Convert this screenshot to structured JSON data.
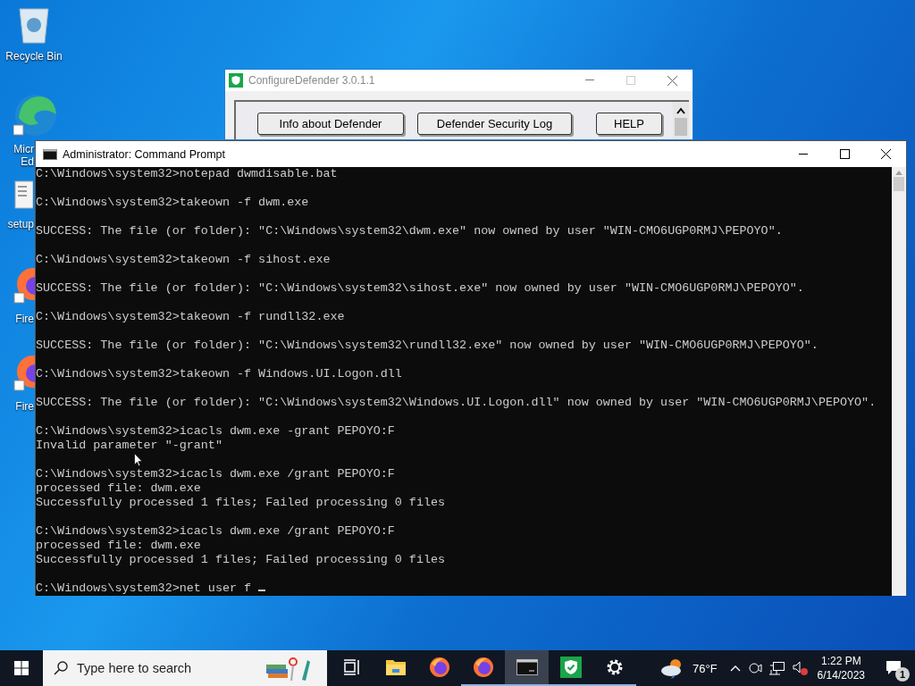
{
  "desktop_icons": [
    {
      "kind": "recycle-bin",
      "label_lines": [
        "Recycle Bin"
      ]
    },
    {
      "kind": "edge",
      "label_lines": [
        "Micr",
        "Ed"
      ]
    },
    {
      "kind": "setup",
      "label_lines": [
        "setup"
      ]
    },
    {
      "kind": "firefox",
      "label_lines": [
        "Fire"
      ]
    },
    {
      "kind": "firefox",
      "label_lines": [
        "Fire"
      ]
    }
  ],
  "defender_window": {
    "title": "ConfigureDefender 3.0.1.1",
    "buttons": [
      "Info about Defender",
      "Defender Security Log",
      "HELP"
    ]
  },
  "console_window": {
    "title": "Administrator: Command Prompt",
    "blocks": [
      [
        "C:\\Windows\\system32>notepad dwmdisable.bat"
      ],
      [
        "C:\\Windows\\system32>takeown -f dwm.exe"
      ],
      [
        "SUCCESS: The file (or folder): \"C:\\Windows\\system32\\dwm.exe\" now owned by user \"WIN-CMO6UGP0RMJ\\PEPOYO\"."
      ],
      [
        "C:\\Windows\\system32>takeown -f sihost.exe"
      ],
      [
        "SUCCESS: The file (or folder): \"C:\\Windows\\system32\\sihost.exe\" now owned by user \"WIN-CMO6UGP0RMJ\\PEPOYO\"."
      ],
      [
        "C:\\Windows\\system32>takeown -f rundll32.exe"
      ],
      [
        "SUCCESS: The file (or folder): \"C:\\Windows\\system32\\rundll32.exe\" now owned by user \"WIN-CMO6UGP0RMJ\\PEPOYO\"."
      ],
      [
        "C:\\Windows\\system32>takeown -f Windows.UI.Logon.dll"
      ],
      [
        "SUCCESS: The file (or folder): \"C:\\Windows\\system32\\Windows.UI.Logon.dll\" now owned by user \"WIN-CMO6UGP0RMJ\\PEPOYO\"."
      ],
      [
        "C:\\Windows\\system32>icacls dwm.exe -grant PEPOYO:F",
        "Invalid parameter \"-grant\""
      ],
      [
        "C:\\Windows\\system32>icacls dwm.exe /grant PEPOYO:F",
        "processed file: dwm.exe",
        "Successfully processed 1 files; Failed processing 0 files"
      ],
      [
        "C:\\Windows\\system32>icacls dwm.exe /grant PEPOYO:F",
        "processed file: dwm.exe",
        "Successfully processed 1 files; Failed processing 0 files"
      ],
      [
        "C:\\Windows\\system32>net user f "
      ]
    ]
  },
  "taskbar": {
    "search": {
      "placeholder": "Type here to search"
    },
    "apps": [
      {
        "kind": "task-view",
        "running": false,
        "selected": false
      },
      {
        "kind": "explorer",
        "running": false,
        "selected": false
      },
      {
        "kind": "firefox",
        "running": false,
        "selected": false
      },
      {
        "kind": "firefox",
        "running": true,
        "selected": false
      },
      {
        "kind": "terminal",
        "running": true,
        "selected": true
      },
      {
        "kind": "shield",
        "running": true,
        "selected": false
      },
      {
        "kind": "gear",
        "running": true,
        "selected": false
      }
    ],
    "weather": {
      "temperature": "76°F"
    },
    "clock": {
      "time": "1:22 PM",
      "date": "6/14/2023"
    },
    "notifications": {
      "count": "1"
    }
  }
}
